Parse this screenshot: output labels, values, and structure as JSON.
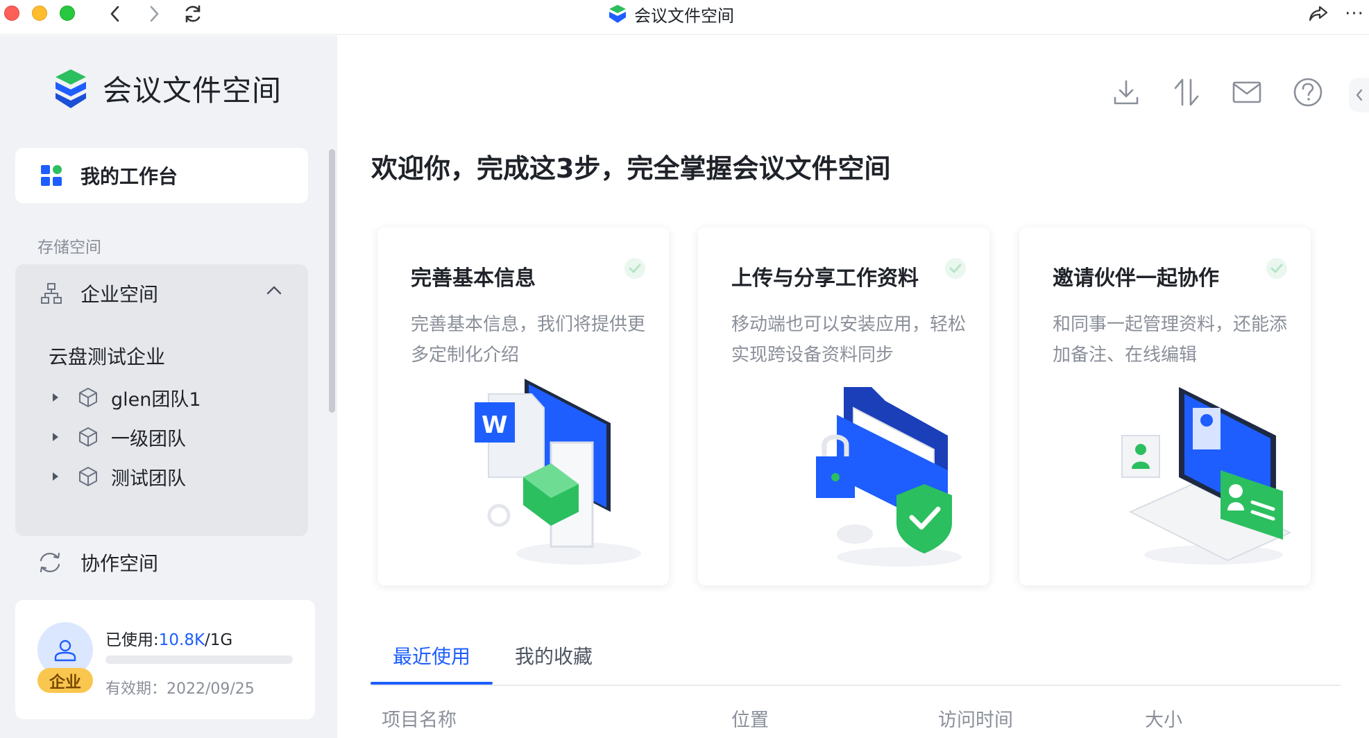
{
  "window": {
    "title": "会议文件空间",
    "icons": {
      "back": "chevron-left-icon",
      "forward": "chevron-right-icon",
      "reload": "reload-icon",
      "share": "share-icon",
      "more": "more-icon"
    },
    "more_label": "···"
  },
  "sidebar": {
    "brand_name": "会议文件空间",
    "workspace_label": "我的工作台",
    "storage_section_label": "存储空间",
    "enterprise_label": "企业空间",
    "company_name": "云盘测试企业",
    "teams": [
      {
        "label": "glen团队1"
      },
      {
        "label": "一级团队"
      },
      {
        "label": "测试团队"
      }
    ],
    "collab_label": "协作空间",
    "storage": {
      "used_prefix": "已使用:",
      "used_value": "10.8K",
      "total_suffix": "/1G",
      "badge": "企业",
      "expiry": "有效期：2022/09/25",
      "usage_fraction": 0.0
    }
  },
  "main": {
    "welcome": "欢迎你，完成这3步，完全掌握会议文件空间",
    "toolbar_icons": [
      "download-icon",
      "sort-icon",
      "mail-icon",
      "help-icon",
      "collapse-icon"
    ],
    "cards": [
      {
        "title": "完善基本信息",
        "desc": "完善基本信息，我们将提供更多定制化介绍"
      },
      {
        "title": "上传与分享工作资料",
        "desc": "移动端也可以安装应用，轻松实现跨设备资料同步"
      },
      {
        "title": "邀请伙伴一起协作",
        "desc": "和同事一起管理资料，还能添加备注、在线编辑"
      }
    ],
    "tabs": [
      {
        "label": "最近使用"
      },
      {
        "label": "我的收藏"
      }
    ],
    "table_headers": [
      "项目名称",
      "位置",
      "访问时间",
      "大小"
    ]
  },
  "colors": {
    "accent": "#1e5eff",
    "brand_green": "#2bbf5f",
    "sidebar_bg": "#f0f2f5",
    "badge_yellow": "#f9c74f"
  }
}
